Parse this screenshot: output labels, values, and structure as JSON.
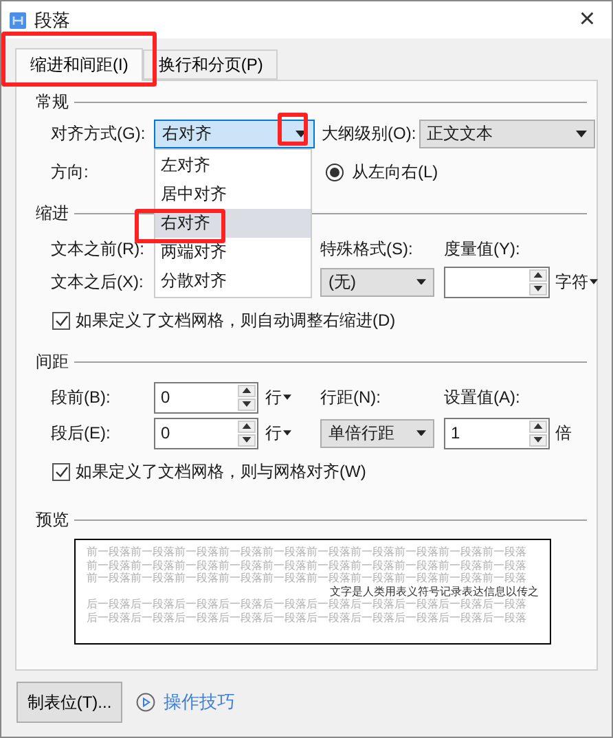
{
  "window": {
    "title": "段落",
    "close": "×"
  },
  "tabs": [
    {
      "label": "缩进和间距(I)",
      "selected": true,
      "highlighted": true
    },
    {
      "label": "换行和分页(P)",
      "selected": false,
      "highlighted": false
    }
  ],
  "general": {
    "heading": "常规",
    "alignment": {
      "label": "对齐方式(G):",
      "value": "右对齐",
      "focused": true,
      "expanded": true,
      "arrow_highlighted": true,
      "options": [
        {
          "label": "左对齐",
          "selected": false,
          "highlighted": false
        },
        {
          "label": "居中对齐",
          "selected": false,
          "highlighted": false
        },
        {
          "label": "右对齐",
          "selected": true,
          "highlighted": true
        },
        {
          "label": "两端对齐",
          "selected": false,
          "highlighted": false
        },
        {
          "label": "分散对齐",
          "selected": false,
          "highlighted": false
        }
      ]
    },
    "outline_level": {
      "label": "大纲级别(O):",
      "value": "正文文本"
    },
    "direction": {
      "label": "方向:",
      "options": [
        {
          "label": "从左向右(L)",
          "selected": true
        }
      ]
    }
  },
  "indent": {
    "heading": "缩进",
    "before": {
      "label": "文本之前(R):"
    },
    "after": {
      "label": "文本之后(X):"
    },
    "special": {
      "label": "特殊格式(S):",
      "value": "(无)"
    },
    "measure": {
      "label": "度量值(Y):",
      "unit": "字符"
    },
    "checkbox": {
      "label": "如果定义了文档网格，则自动调整右缩进(D)",
      "checked": true
    }
  },
  "spacing": {
    "heading": "间距",
    "before": {
      "label": "段前(B):",
      "value": "0",
      "unit": "行"
    },
    "after": {
      "label": "段后(E):",
      "value": "0",
      "unit": "行"
    },
    "line_spacing": {
      "label": "行距(N):",
      "value": "单倍行距"
    },
    "set_value": {
      "label": "设置值(A):",
      "value": "1",
      "unit": "倍"
    },
    "checkbox": {
      "label": "如果定义了文档网格，则与网格对齐(W)",
      "checked": true
    }
  },
  "preview": {
    "heading": "预览",
    "lines": [
      {
        "kind": "before",
        "text": "前一段落前一段落前一段落前一段落前一段落前一段落前一段落前一段落前一段落前一段落"
      },
      {
        "kind": "before",
        "text": "前一段落前一段落前一段落前一段落前一段落前一段落前一段落前一段落前一段落前一段落"
      },
      {
        "kind": "before",
        "text": "前一段落前一段落前一段落前一段落前一段落前一段落前一段落前一段落前一段落前一段落"
      },
      {
        "kind": "current",
        "text": "文字是人类用表义符号记录表达信息以传之"
      },
      {
        "kind": "after",
        "text": "后一段落后一段落后一段落后一段落后一段落后一段落后一段落后一段落后一段落后一段落"
      },
      {
        "kind": "after",
        "text": "后一段落后一段落后一段落后一段落后一段落后一段落后一段落后一段落后一段落后一段落"
      }
    ]
  },
  "footer": {
    "tabs_button": "制表位(T)...",
    "tips_link": "操作技巧"
  }
}
